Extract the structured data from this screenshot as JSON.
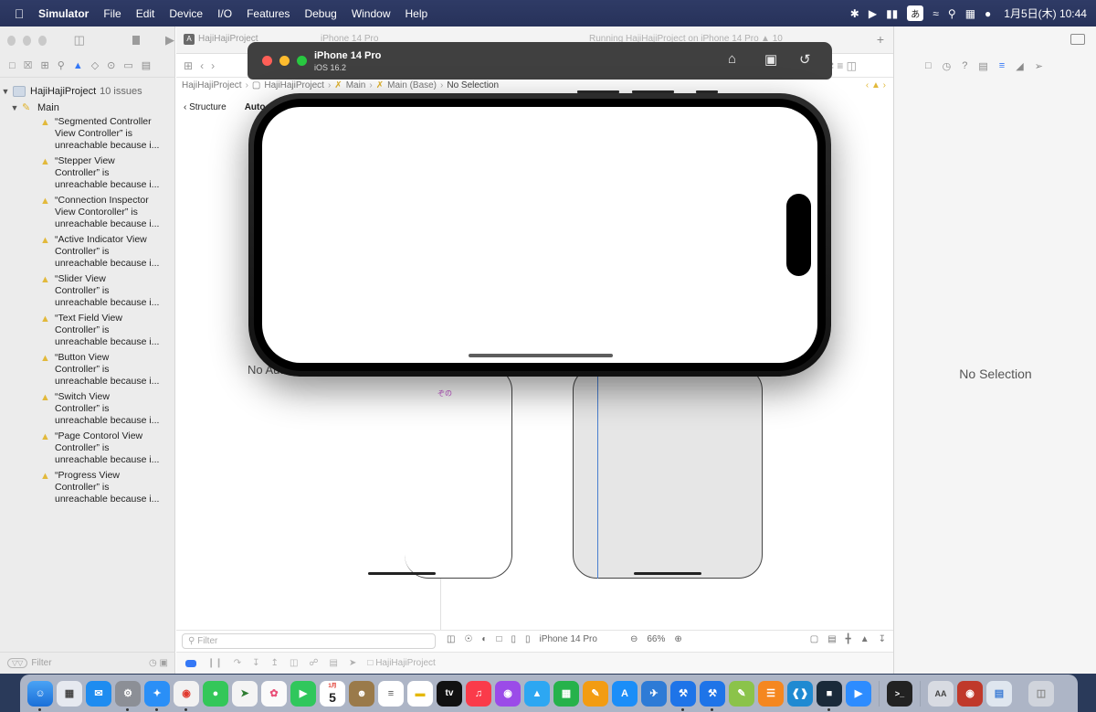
{
  "menubar": {
    "app_name": "Simulator",
    "menus": [
      "File",
      "Edit",
      "Device",
      "I/O",
      "Features",
      "Debug",
      "Window",
      "Help"
    ],
    "ime_label": "あ",
    "clock": "1月5日(木)  10:44"
  },
  "xcode": {
    "tab_project": "HajiHajiProject",
    "tab_device": "iPhone 14 Pro",
    "tab_status": "Running HajiHajiProject on iPhone 14 Pro",
    "tab_warn_count": "10",
    "jumpbar": [
      "HajiHajiProject",
      "HajiHajiProject",
      "Main",
      "Main (Base)",
      "No Selection"
    ],
    "navigator": {
      "project": "HajiHajiProject",
      "issue_count": "10 issues",
      "group": "Main",
      "issues": [
        [
          "“Segmented Controller",
          "View Controller” is",
          "unreachable because i..."
        ],
        [
          "“Stepper View",
          "Controller” is",
          "unreachable because i..."
        ],
        [
          "“Connection Inspector",
          "View Contoroller” is",
          "unreachable because i..."
        ],
        [
          "“Active Indicator View",
          "Controller” is",
          "unreachable because i..."
        ],
        [
          "“Slider View",
          "Controller” is",
          "unreachable because i..."
        ],
        [
          "“Text Field View",
          "Controller” is",
          "unreachable because i..."
        ],
        [
          "“Button View",
          "Controller” is",
          "unreachable because i..."
        ],
        [
          "“Switch View",
          "Controller” is",
          "unreachable because i..."
        ],
        [
          "“Page Contorol View",
          "Controller” is",
          "unreachable because i..."
        ],
        [
          "“Progress View",
          "Controller” is",
          "unreachable because i..."
        ]
      ],
      "filter_placeholder": "Filter"
    },
    "outline": {
      "tab_structure": "Structure",
      "tab_autolayout": "Auto",
      "message": "No Auto Layout Issues",
      "filter_placeholder": "Filter"
    },
    "canvas_label": "ぞの",
    "bottombar": {
      "device": "iPhone 14 Pro",
      "zoom": "66%"
    },
    "debug_target": "HajiHajiProject",
    "inspector_message": "No Selection"
  },
  "simulator": {
    "title": "iPhone 14 Pro",
    "subtitle": "iOS 16.2"
  },
  "dock": {
    "calendar_month": "1月",
    "calendar_day": "5",
    "tv_label": "tv"
  }
}
